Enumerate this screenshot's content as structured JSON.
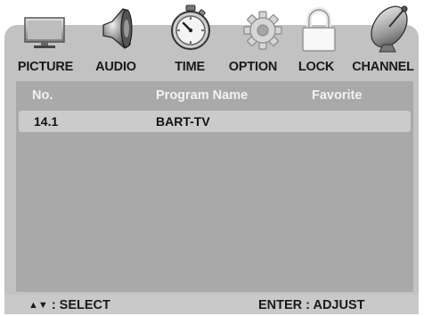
{
  "menu": {
    "tabs": [
      {
        "label": "PICTURE",
        "icon": "tv-icon"
      },
      {
        "label": "AUDIO",
        "icon": "speaker-icon"
      },
      {
        "label": "TIME",
        "icon": "stopwatch-icon"
      },
      {
        "label": "OPTION",
        "icon": "gear-icon"
      },
      {
        "label": "LOCK",
        "icon": "padlock-icon"
      },
      {
        "label": "CHANNEL",
        "icon": "satellite-dish-icon"
      }
    ],
    "active_tab": "CHANNEL"
  },
  "table": {
    "headers": {
      "number": "No.",
      "name": "Program Name",
      "favorite": "Favorite"
    },
    "rows": [
      {
        "number": "14.1",
        "name": "BART-TV",
        "favorite": ""
      }
    ]
  },
  "footer": {
    "select_arrows": "▲▼",
    "select_label": ": SELECT",
    "enter_label": "ENTER : ADJUST"
  },
  "colors": {
    "frame": "#c2c2c2",
    "panel": "#a9a9a9",
    "selected_row": "#cbcbcb",
    "header_text": "#f2f2f2"
  }
}
